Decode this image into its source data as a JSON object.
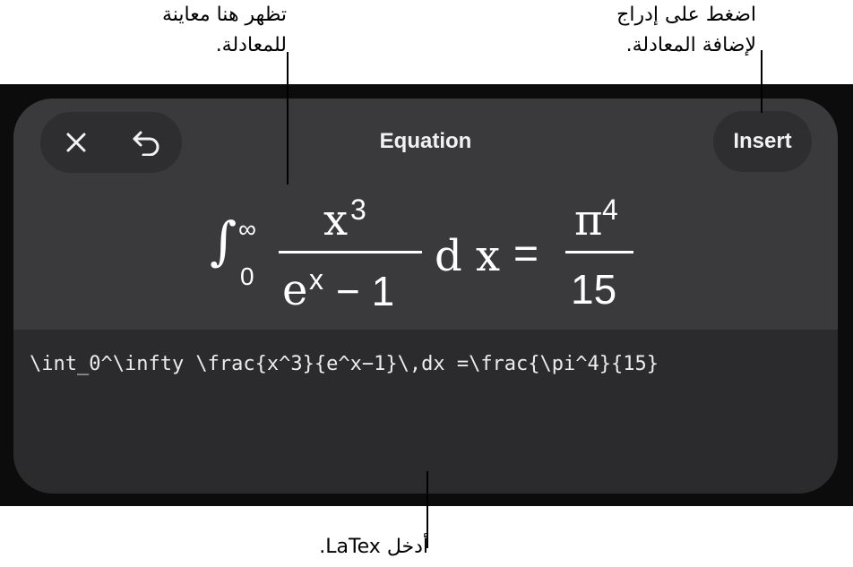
{
  "callouts": {
    "preview": [
      "تظهر هنا معاينة",
      "للمعادلة."
    ],
    "insert": [
      "اضغط على إدراج",
      "لإضافة المعادلة."
    ],
    "latex": "أدخل LaTex."
  },
  "toolbar": {
    "title": "Equation",
    "insert_label": "Insert",
    "close_icon": "close-icon",
    "undo_icon": "undo-icon"
  },
  "preview": {
    "integral_sign": "∫",
    "lower_limit": "0",
    "upper_limit": "∞",
    "numerator_base": "x",
    "numerator_exp": "3",
    "denominator_base": "e",
    "denominator_exp": "x",
    "denominator_rest": "− 1",
    "differential": "d x",
    "equals": "=",
    "rhs_numerator_base": "π",
    "rhs_numerator_exp": "4",
    "rhs_denominator": "15"
  },
  "input": {
    "latex": "\\int_0^\\infty \\frac{x^3}{e^x−1}\\,dx =\\frac{\\pi^4}{15}"
  },
  "colors": {
    "backdrop": "#0c0c0c",
    "panel": "#2b2b2d",
    "preview_bg": "#3a3a3c",
    "button_bg": "#2e2e30",
    "text": "#ffffff"
  }
}
